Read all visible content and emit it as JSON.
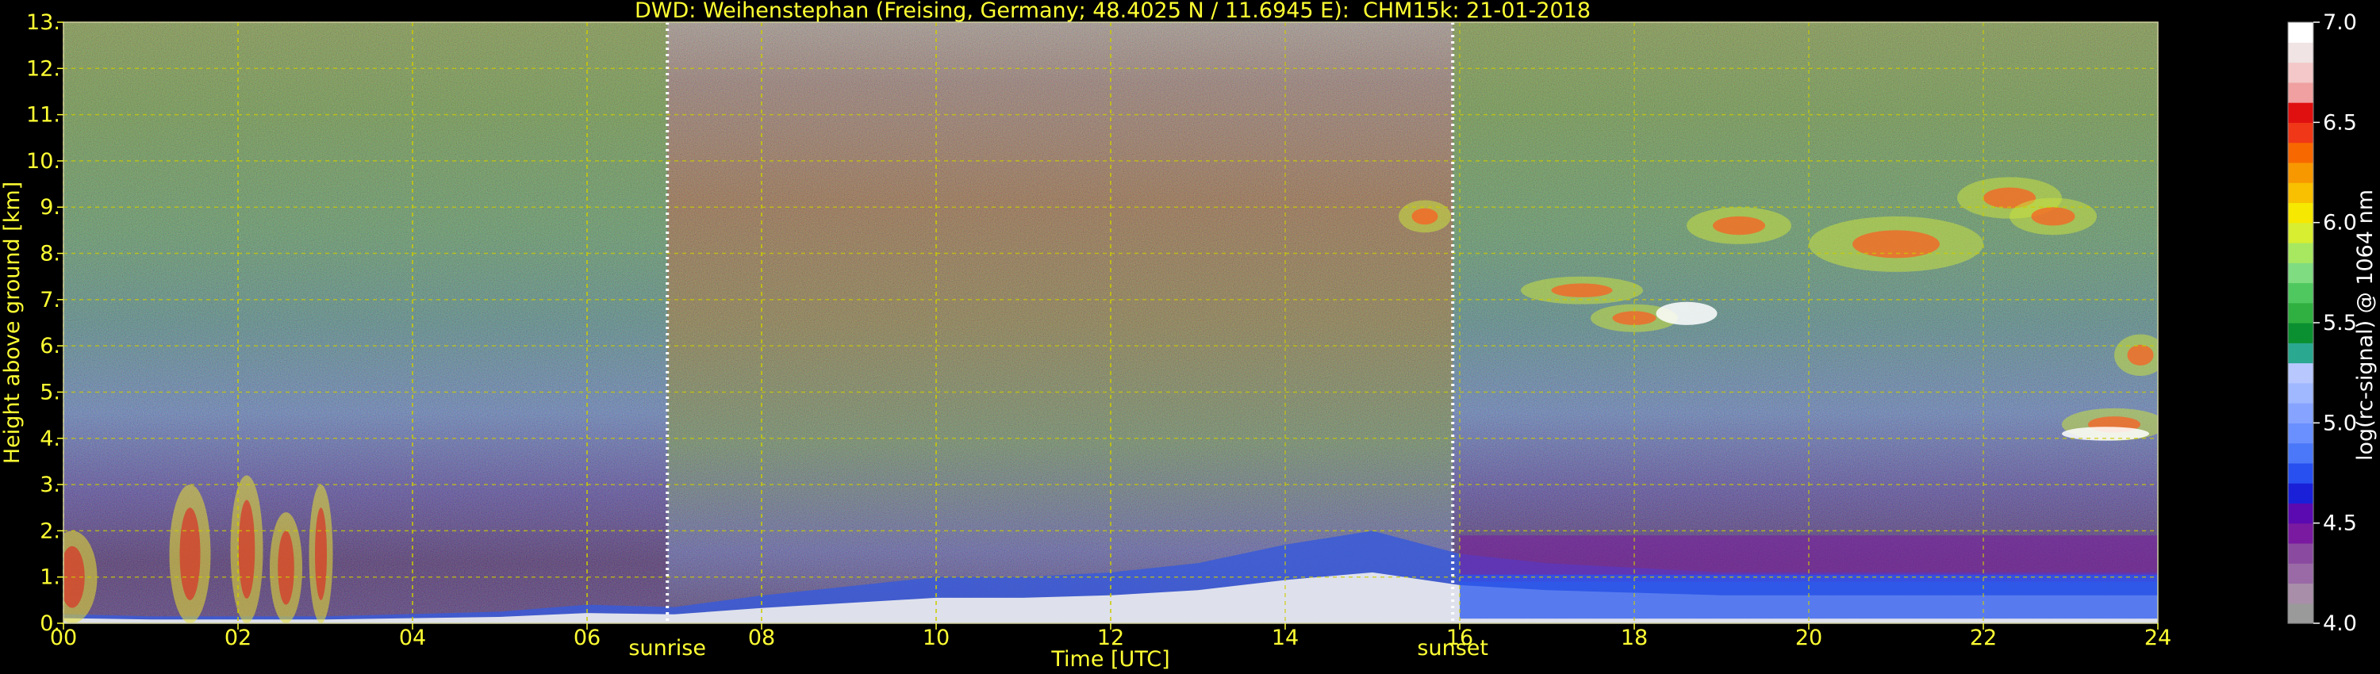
{
  "header": {
    "station": "DWD: Weihenstephan (Freising, Germany; 48.4025 N / 11.6945 E):",
    "instrument": "CHM15k: 21-01-2018"
  },
  "colors": {
    "text": "#ffff33",
    "background": "#000000",
    "grid": "#cccc00",
    "marker_line": "#ffffff"
  },
  "chart_data": {
    "type": "heatmap",
    "title": "DWD: Weihenstephan (Freising, Germany; 48.4025 N / 11.6945 E):    CHM15k: 21-01-2018",
    "xlabel": "Time [UTC]",
    "ylabel": "Height above ground [km]",
    "xlim": [
      0,
      24
    ],
    "ylim": [
      0,
      13
    ],
    "grid": true,
    "x_ticks": [
      "00",
      "02",
      "04",
      "06",
      "08",
      "10",
      "12",
      "14",
      "16",
      "18",
      "20",
      "22",
      "24"
    ],
    "y_ticks": [
      "0.",
      "1.",
      "2.",
      "3.",
      "4.",
      "5.",
      "6.",
      "7.",
      "8.",
      "9.",
      "10.",
      "11.",
      "12.",
      "13."
    ],
    "annotations": [
      {
        "label": "sunrise",
        "x": 6.92
      },
      {
        "label": "sunset",
        "x": 15.92
      }
    ],
    "colorbar": {
      "label": "log(rc-signal) @ 1064 nm",
      "range": [
        4.0,
        7.0
      ],
      "ticks": [
        "4.0",
        "4.5",
        "5.0",
        "5.5",
        "6.0",
        "6.5",
        "7.0"
      ],
      "colors": [
        "#9a9a9a",
        "#a98ea9",
        "#9a6aa6",
        "#8a4aa0",
        "#7a1aa0",
        "#5a0ab0",
        "#1a20d8",
        "#2850f0",
        "#4a78f8",
        "#6a90ff",
        "#86a4ff",
        "#a0b8ff",
        "#b8c8ff",
        "#2aa890",
        "#0a9030",
        "#30b040",
        "#50c860",
        "#80dc80",
        "#a8e860",
        "#d8ee30",
        "#f6e800",
        "#f8c000",
        "#f89800",
        "#f86800",
        "#f03818",
        "#e01010",
        "#f0a0a0",
        "#f4c8c8",
        "#f0e4e4",
        "#ffffff"
      ]
    },
    "features": [
      {
        "name": "boundary-layer",
        "x": [
          0,
          1,
          2,
          3,
          4,
          5,
          6,
          7,
          8,
          9,
          10,
          11,
          12,
          13,
          14,
          15,
          16,
          17,
          18,
          19,
          20,
          21,
          22,
          23,
          24
        ],
        "top_km": [
          0.2,
          0.15,
          0.15,
          0.15,
          0.2,
          0.25,
          0.4,
          0.35,
          0.6,
          0.8,
          1.0,
          1.0,
          1.1,
          1.3,
          1.7,
          2.0,
          1.5,
          1.3,
          1.2,
          1.1,
          1.1,
          1.1,
          1.1,
          1.1,
          1.1
        ]
      },
      {
        "name": "cirrus-cloud",
        "x_range": [
          15.5,
          24
        ],
        "height_range_km": [
          3.5,
          10.2
        ]
      },
      {
        "name": "low-clouds",
        "x_range": [
          0,
          3.2
        ],
        "height_range_km": [
          0,
          3.2
        ]
      }
    ]
  }
}
